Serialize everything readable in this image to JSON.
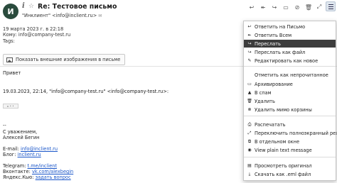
{
  "header": {
    "avatar_letter": "И",
    "subject": "Re: Тестовое письмо",
    "from_name": "\"Инклиент\" <info@inclient.ru>"
  },
  "meta": {
    "date": "19 марта 2023 г. в 22:18",
    "to": "Кому: info@company-test.ru",
    "tags": "Tags:"
  },
  "external_images_button": "Показать внешние изображения в письме",
  "body": {
    "greeting": "Привет",
    "quote_header": "19.03.2023, 22:14, \"info@company-test.ru\" <info@company-test.ru>:",
    "dashes": "--",
    "regards": "С уважением,",
    "signature_name": "Алексей Бегин",
    "email_label": "E-mail: ",
    "email_link": "info@inclient.ru",
    "blog_label": "Блог: ",
    "blog_link": "inclient.ru",
    "telegram_label": "Telegram: ",
    "telegram_link": "t.me/inclient",
    "vk_label": "Вконтакте: ",
    "vk_link": "vk.com/alexbegin",
    "yandex_label": "Яндекс.Кью: ",
    "yandex_link": "задать вопрос"
  },
  "menu": {
    "items": [
      {
        "label": "Ответить на Письмо",
        "icon": "reply-icon"
      },
      {
        "label": "Ответить Всем",
        "icon": "reply-all-icon"
      },
      {
        "label": "Переслать",
        "icon": "forward-icon"
      },
      {
        "label": "Переслать как файл",
        "icon": "forward-file-icon"
      },
      {
        "label": "Редактировать как новое",
        "icon": "edit-icon"
      },
      {
        "label": "Отметить как непрочитанное",
        "icon": ""
      },
      {
        "label": "Архивирование",
        "icon": "archive-icon"
      },
      {
        "label": "В спам",
        "icon": "spam-icon"
      },
      {
        "label": "Удалить",
        "icon": "trash-icon"
      },
      {
        "label": "Удалить мимо корзины",
        "icon": "delete-permanent-icon"
      },
      {
        "label": "Распечатать",
        "icon": "print-icon"
      },
      {
        "label": "Переключить полноэкранный режим",
        "icon": "fullscreen-icon"
      },
      {
        "label": "В отдельном окне",
        "icon": "new-window-icon"
      },
      {
        "label": "View plain text message",
        "icon": "eye-icon"
      },
      {
        "label": "Просмотреть оригинал",
        "icon": "document-icon"
      },
      {
        "label": "Скачать как .eml файл",
        "icon": "download-icon"
      }
    ]
  }
}
